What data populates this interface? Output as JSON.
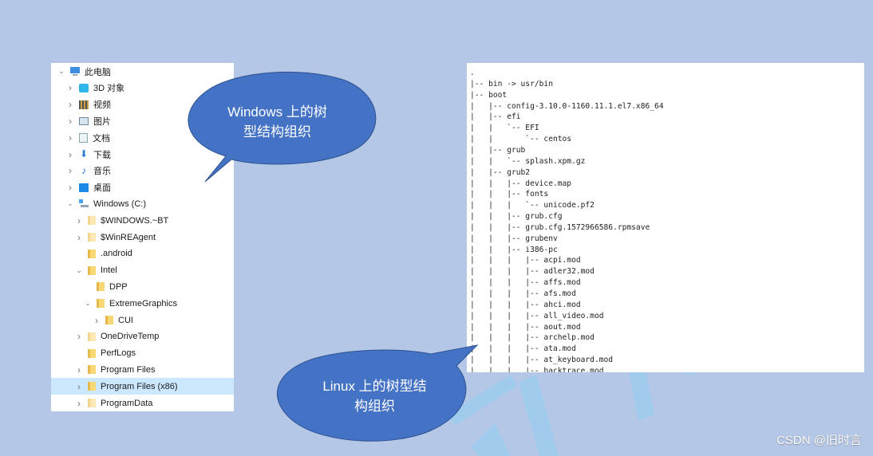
{
  "windows_tree": {
    "items": [
      {
        "label": "此电脑",
        "icon": "pc-icon",
        "chevron": "down",
        "indent": 0
      },
      {
        "label": "3D 对象",
        "icon": "3d-objects-icon",
        "chevron": "right",
        "indent": 1
      },
      {
        "label": "视频",
        "icon": "video-icon",
        "chevron": "right",
        "indent": 1
      },
      {
        "label": "图片",
        "icon": "pictures-icon",
        "chevron": "right",
        "indent": 1
      },
      {
        "label": "文档",
        "icon": "documents-icon",
        "chevron": "right",
        "indent": 1
      },
      {
        "label": "下载",
        "icon": "download-icon",
        "chevron": "right",
        "indent": 1
      },
      {
        "label": "音乐",
        "icon": "music-icon",
        "chevron": "right",
        "indent": 1
      },
      {
        "label": "桌面",
        "icon": "desktop-icon",
        "chevron": "right",
        "indent": 1
      },
      {
        "label": "Windows (C:)",
        "icon": "drive-icon",
        "chevron": "down",
        "indent": 1
      },
      {
        "label": "$WINDOWS.~BT",
        "icon": "folder-icon",
        "chevron": "right",
        "indent": 2
      },
      {
        "label": "$WinREAgent",
        "icon": "folder-icon",
        "chevron": "right",
        "indent": 2
      },
      {
        "label": ".android",
        "icon": "folder-icon",
        "chevron": "",
        "indent": 2
      },
      {
        "label": "Intel",
        "icon": "folder-icon",
        "chevron": "down",
        "indent": 2
      },
      {
        "label": "DPP",
        "icon": "folder-icon",
        "chevron": "",
        "indent": 3
      },
      {
        "label": "ExtremeGraphics",
        "icon": "folder-icon",
        "chevron": "down",
        "indent": 3
      },
      {
        "label": "CUI",
        "icon": "folder-icon",
        "chevron": "right",
        "indent": 4
      },
      {
        "label": "OneDriveTemp",
        "icon": "folder-icon",
        "chevron": "right",
        "indent": 2
      },
      {
        "label": "PerfLogs",
        "icon": "folder-icon",
        "chevron": "",
        "indent": 2
      },
      {
        "label": "Program Files",
        "icon": "folder-icon",
        "chevron": "right",
        "indent": 2
      },
      {
        "label": "Program Files (x86)",
        "icon": "folder-icon",
        "chevron": "right",
        "indent": 2,
        "selected": true
      },
      {
        "label": "ProgramData",
        "icon": "folder-icon",
        "chevron": "right",
        "indent": 2
      }
    ]
  },
  "linux_tree": {
    "lines": [
      ".",
      "|-- bin -> usr/bin",
      "|-- boot",
      "|   |-- config-3.10.0-1160.11.1.el7.x86_64",
      "|   |-- efi",
      "|   |   `-- EFI",
      "|   |       `-- centos",
      "|   |-- grub",
      "|   |   `-- splash.xpm.gz",
      "|   |-- grub2",
      "|   |   |-- device.map",
      "|   |   |-- fonts",
      "|   |   |   `-- unicode.pf2",
      "|   |   |-- grub.cfg",
      "|   |   |-- grub.cfg.1572966586.rpmsave",
      "|   |   |-- grubenv",
      "|   |   |-- i386-pc",
      "|   |   |   |-- acpi.mod",
      "|   |   |   |-- adler32.mod",
      "|   |   |   |-- affs.mod",
      "|   |   |   |-- afs.mod",
      "|   |   |   |-- ahci.mod",
      "|   |   |   |-- all_video.mod",
      "|   |   |   |-- aout.mod",
      "|   |   |   |-- archelp.mod",
      "|   |   |   |-- ata.mod",
      "|   |   |   |-- at_keyboard.mod",
      "|   |   |   |-- backtrace.mod"
    ]
  },
  "callouts": {
    "windows": {
      "line1": "Windows 上的树",
      "line2": "型结构组织"
    },
    "linux": {
      "line1": "Linux 上的树型结",
      "line2": "构组织"
    }
  },
  "watermark": {
    "text": "CSDN @旧时言"
  },
  "colors": {
    "background": "#b4c7e7",
    "bubble_fill": "#4472c4",
    "bubble_stroke": "#2f528f",
    "selected_row": "#cce8ff"
  }
}
